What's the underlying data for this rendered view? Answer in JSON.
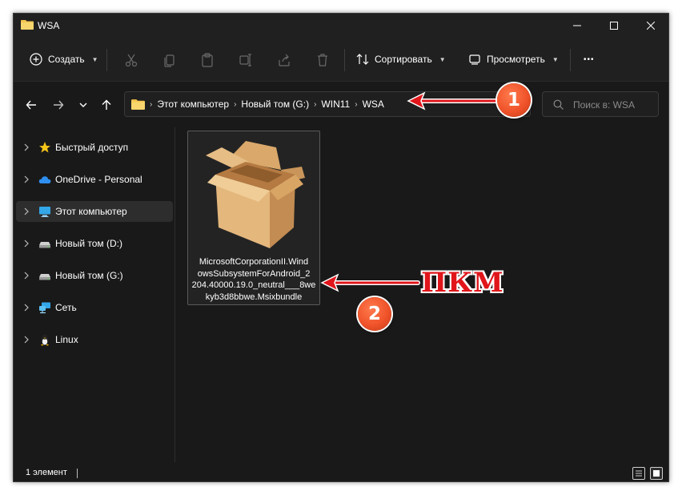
{
  "window": {
    "title": "WSA"
  },
  "toolbar": {
    "create_label": "Создать",
    "sort_label": "Сортировать",
    "view_label": "Просмотреть",
    "more_label": "•••"
  },
  "address": {
    "crumbs": [
      "Этот компьютер",
      "Новый том (G:)",
      "WIN11",
      "WSA"
    ]
  },
  "search": {
    "placeholder": "Поиск в: WSA"
  },
  "sidebar": {
    "items": [
      {
        "label": "Быстрый доступ",
        "icon": "star-icon"
      },
      {
        "label": "OneDrive - Personal",
        "icon": "cloud-icon"
      },
      {
        "label": "Этот компьютер",
        "icon": "monitor-icon"
      },
      {
        "label": "Новый том (D:)",
        "icon": "drive-icon"
      },
      {
        "label": "Новый том (G:)",
        "icon": "drive-icon"
      },
      {
        "label": "Сеть",
        "icon": "network-icon"
      },
      {
        "label": "Linux",
        "icon": "linux-penguin-icon"
      }
    ],
    "active_index": 2
  },
  "files": [
    {
      "name_lines": [
        "MicrosoftCorporationII.Wind",
        "owsSubsystemForAndroid_2",
        "204.40000.19.0_neutral___8we",
        "kyb3d8bbwe.Msixbundle"
      ],
      "icon": "package-box-icon"
    }
  ],
  "status": {
    "count_text": "1 элемент"
  },
  "annotations": {
    "badge1": "1",
    "badge2": "2",
    "rmb_label": "ПКМ"
  },
  "colors": {
    "window_bg": "#191919",
    "chrome_bg": "#202020",
    "folder_yellow": "#f4c64f",
    "annotation_red": "#e0161b",
    "badge_orange": "#f0532a"
  }
}
